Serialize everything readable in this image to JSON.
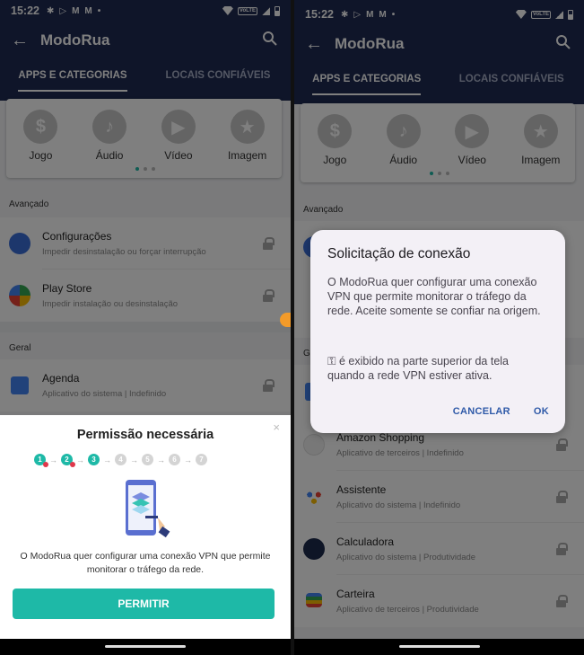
{
  "status": {
    "time": "15:22",
    "notif_icons": [
      "settings-icon",
      "play-outline-icon",
      "gmail-icon",
      "gmail-icon",
      "dot-icon"
    ],
    "volte": "VoLTE"
  },
  "appbar": {
    "title": "ModoRua"
  },
  "tabs": [
    {
      "label": "APPS E CATEGORIAS"
    },
    {
      "label": "LOCAIS CONFIÁVEIS"
    }
  ],
  "categories": [
    {
      "label": "Jogo",
      "icon": "dollar-icon"
    },
    {
      "label": "Áudio",
      "icon": "music-note-icon"
    },
    {
      "label": "Vídeo",
      "icon": "play-icon"
    },
    {
      "label": "Imagem",
      "icon": "star-icon"
    }
  ],
  "left": {
    "section_advanced": "Avançado",
    "section_general": "Geral",
    "advanced_items": [
      {
        "title": "Configurações",
        "subtitle": "Impedir desinstalação ou forçar interrupção"
      },
      {
        "title": "Play Store",
        "subtitle": "Impedir instalação ou desinstalação"
      }
    ],
    "general_items": [
      {
        "title": "Agenda",
        "subtitle": "Aplicativo do sistema | Indefinido"
      }
    ],
    "sheet": {
      "title": "Permissão necessária",
      "steps": [
        "1",
        "2",
        "3",
        "4",
        "5",
        "6",
        "7"
      ],
      "message": "O ModoRua quer configurar uma conexão VPN que permite monitorar o tráfego da rede.",
      "button": "PERMITIR",
      "close": "×"
    }
  },
  "right": {
    "section_advanced": "Avançado",
    "section_general": "G",
    "items": [
      {
        "title": "Amazon Shopping",
        "subtitle": "Aplicativo de terceiros | Indefinido"
      },
      {
        "title": "Assistente",
        "subtitle": "Aplicativo do sistema | Indefinido"
      },
      {
        "title": "Calculadora",
        "subtitle": "Aplicativo do sistema | Produtividade"
      },
      {
        "title": "Carteira",
        "subtitle": "Aplicativo de terceiros | Produtividade"
      }
    ],
    "dialog": {
      "title": "Solicitação de conexão",
      "body": "O ModoRua quer configurar uma conexão VPN que permite monitorar o tráfego da rede. Aceite somente se confiar na origem.",
      "body2_icon": "key-icon",
      "body2": "é exibido na parte superior da tela quando a rede VPN estiver ativa.",
      "cancel": "CANCELAR",
      "ok": "OK"
    }
  },
  "colors": {
    "primary": "#1e2a52",
    "accent": "#1eb9a7",
    "dialog_button": "#2f5aa8",
    "badge": "#f39b2a"
  }
}
